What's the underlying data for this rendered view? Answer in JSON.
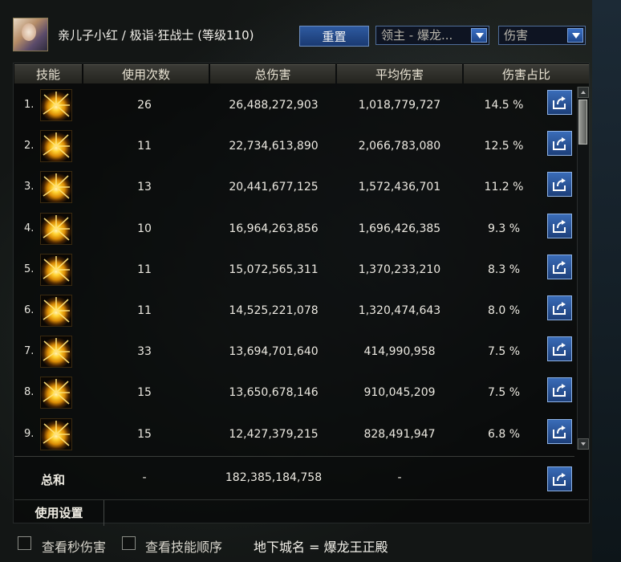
{
  "window": {
    "title": "亲儿子小红 / 极诣·狂战士 (等级110)",
    "reset_label": "重置",
    "target_select": "领主 - 爆龙...",
    "metric_select": "伤害"
  },
  "columns": {
    "skill": "技能",
    "uses": "使用次数",
    "total": "总伤害",
    "avg": "平均伤害",
    "pct": "伤害占比"
  },
  "rows": [
    {
      "rank": "1.",
      "uses": "26",
      "total": "26,488,272,903",
      "avg": "1,018,779,727",
      "pct": "14.5 %",
      "icon": "burst-skill-icon"
    },
    {
      "rank": "2.",
      "uses": "11",
      "total": "22,734,613,890",
      "avg": "2,066,783,080",
      "pct": "12.5 %",
      "icon": "burst-skill-icon"
    },
    {
      "rank": "3.",
      "uses": "13",
      "total": "20,441,677,125",
      "avg": "1,572,436,701",
      "pct": "11.2 %",
      "icon": "burst-skill-icon"
    },
    {
      "rank": "4.",
      "uses": "10",
      "total": "16,964,263,856",
      "avg": "1,696,426,385",
      "pct": "9.3 %",
      "icon": "burst-skill-icon"
    },
    {
      "rank": "5.",
      "uses": "11",
      "total": "15,072,565,311",
      "avg": "1,370,233,210",
      "pct": "8.3 %",
      "icon": "burst-skill-icon"
    },
    {
      "rank": "6.",
      "uses": "11",
      "total": "14,525,221,078",
      "avg": "1,320,474,643",
      "pct": "8.0 %",
      "icon": "burst-skill-icon"
    },
    {
      "rank": "7.",
      "uses": "33",
      "total": "13,694,701,640",
      "avg": "414,990,958",
      "pct": "7.5 %",
      "icon": "burst-skill-icon"
    },
    {
      "rank": "8.",
      "uses": "15",
      "total": "13,650,678,146",
      "avg": "910,045,209",
      "pct": "7.5 %",
      "icon": "burst-skill-icon"
    },
    {
      "rank": "9.",
      "uses": "15",
      "total": "12,427,379,215",
      "avg": "828,491,947",
      "pct": "6.8 %",
      "icon": "burst-skill-icon"
    }
  ],
  "totals": {
    "label": "总和",
    "uses": "-",
    "total": "182,385,184,758",
    "avg": "-"
  },
  "settings_label": "使用设置",
  "bottom": {
    "check_dps": "查看秒伤害",
    "check_order": "查看技能顺序",
    "dungeon": "地下城名 = 爆龙王正殿"
  },
  "colors": {
    "accent_blue": "#2e5aa0",
    "skill_glow": "#ffd230"
  }
}
